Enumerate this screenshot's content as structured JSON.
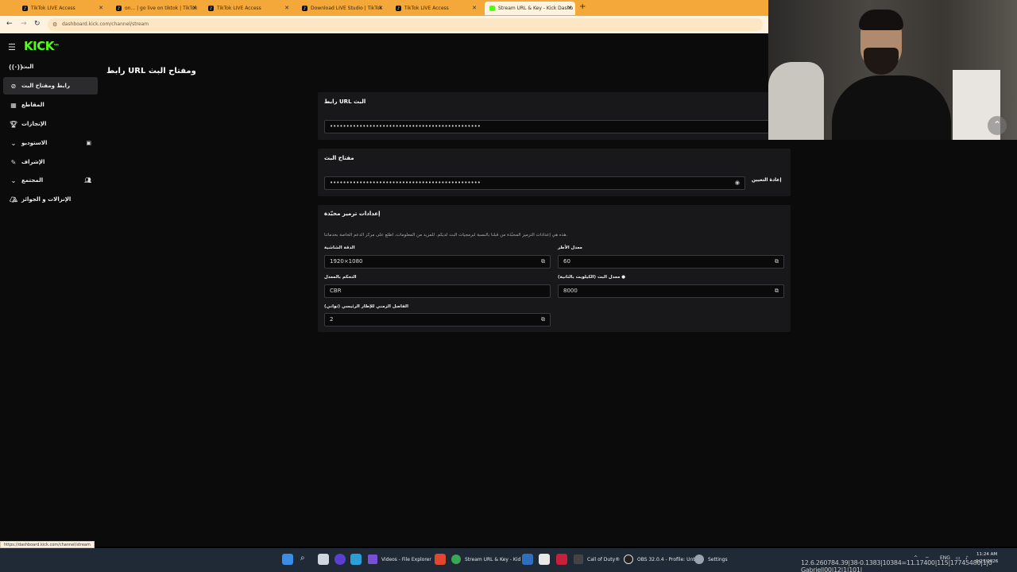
{
  "browser": {
    "tabs": [
      {
        "title": "TikTok LIVE Access",
        "favicon": "tiktok-icon"
      },
      {
        "title": "on... | go live on tiktok | TikTok",
        "favicon": "tiktok-icon"
      },
      {
        "title": "TikTok LIVE Access",
        "favicon": "tiktok-icon"
      },
      {
        "title": "Download LIVE Studio | TikTok",
        "favicon": "tiktok-icon"
      },
      {
        "title": "TikTok LIVE Access",
        "favicon": "tiktok-icon"
      },
      {
        "title": "Stream URL & Key - Kick Dashb",
        "favicon": "kick-icon",
        "active": true
      }
    ],
    "new_tab": "+",
    "url": "dashboard.kick.com/channel/stream",
    "status_url": "https://dashboard.kick.com/channel/stream"
  },
  "kick": {
    "logo": "KICK",
    "logo_sup": "beta",
    "sidebar": [
      {
        "label": "البث",
        "icon": "broadcast-icon"
      },
      {
        "label": "رابط ومفتاح البث",
        "icon": "link-icon",
        "active": true
      },
      {
        "label": "المقاطع",
        "icon": "clips-icon"
      },
      {
        "label": "الإنجازات",
        "icon": "trophy-icon"
      },
      {
        "label": "الاستوديو",
        "icon": "chevron-down-icon",
        "extra": "studio-icon"
      },
      {
        "label": "الإشراف",
        "icon": "wrench-icon"
      },
      {
        "label": "المجتمع",
        "icon": "chevron-down-icon",
        "extra": "users-icon"
      },
      {
        "label": "الإنزالات و الجوائز",
        "icon": "drops-icon"
      }
    ],
    "page_title": "رابط URL ومفتاح البث",
    "url_card": {
      "title": "رابط URL البث",
      "value": "••••••••••••••••••••••••••••••••••••••••••••••"
    },
    "key_card": {
      "title": "مفتاح البث",
      "value": "••••••••••••••••••••••••••••••••••••••••••••••",
      "reset_label": "إعادة التعيين"
    },
    "encoder_card": {
      "title": "إعدادات ترميز محبّذة",
      "description": "هذه هي إعدادات الترميز المحبّذة من قبلنا بالنسبة لبرمجيات البث لديكم. للمزيد من المعلومات، اطلع على مركز الدعم الخاصة بخدماتنا.",
      "resolution_label": "الدقة الشاشية",
      "resolution_value": "1920×1080",
      "framerate_label": "معدل الأطر",
      "framerate_value": "60",
      "rate_control_label": "التحكم بالمعدل",
      "rate_control_value": "CBR",
      "bitrate_label": "معدل البت (الكيلوبت بالثانية)",
      "bitrate_value": "8000",
      "keyframe_label": "الفاصل الزمني للإطار الرئيسي (ثواني)",
      "keyframe_value": "2"
    }
  },
  "taskbar": {
    "items": [
      {
        "label": "Videos - File Explorer"
      },
      {
        "label": "Stream URL & Key - Kid"
      },
      {
        "label": "Call of Duty®"
      },
      {
        "label": "OBS 32.0.4 - Profile: Unt"
      },
      {
        "label": "Settings"
      }
    ],
    "lang": "ENG",
    "time": "11:24 AM",
    "date": "9/27/2026",
    "overlay": "12.6.260784.39|38-0.1383|10384=11.17400|115|17745480|1|0 Gabriel|00|12|1|101|"
  },
  "colors": {
    "accent": "#53fc18",
    "browser_tab": "#f5a83a",
    "panel": "#18181a"
  }
}
